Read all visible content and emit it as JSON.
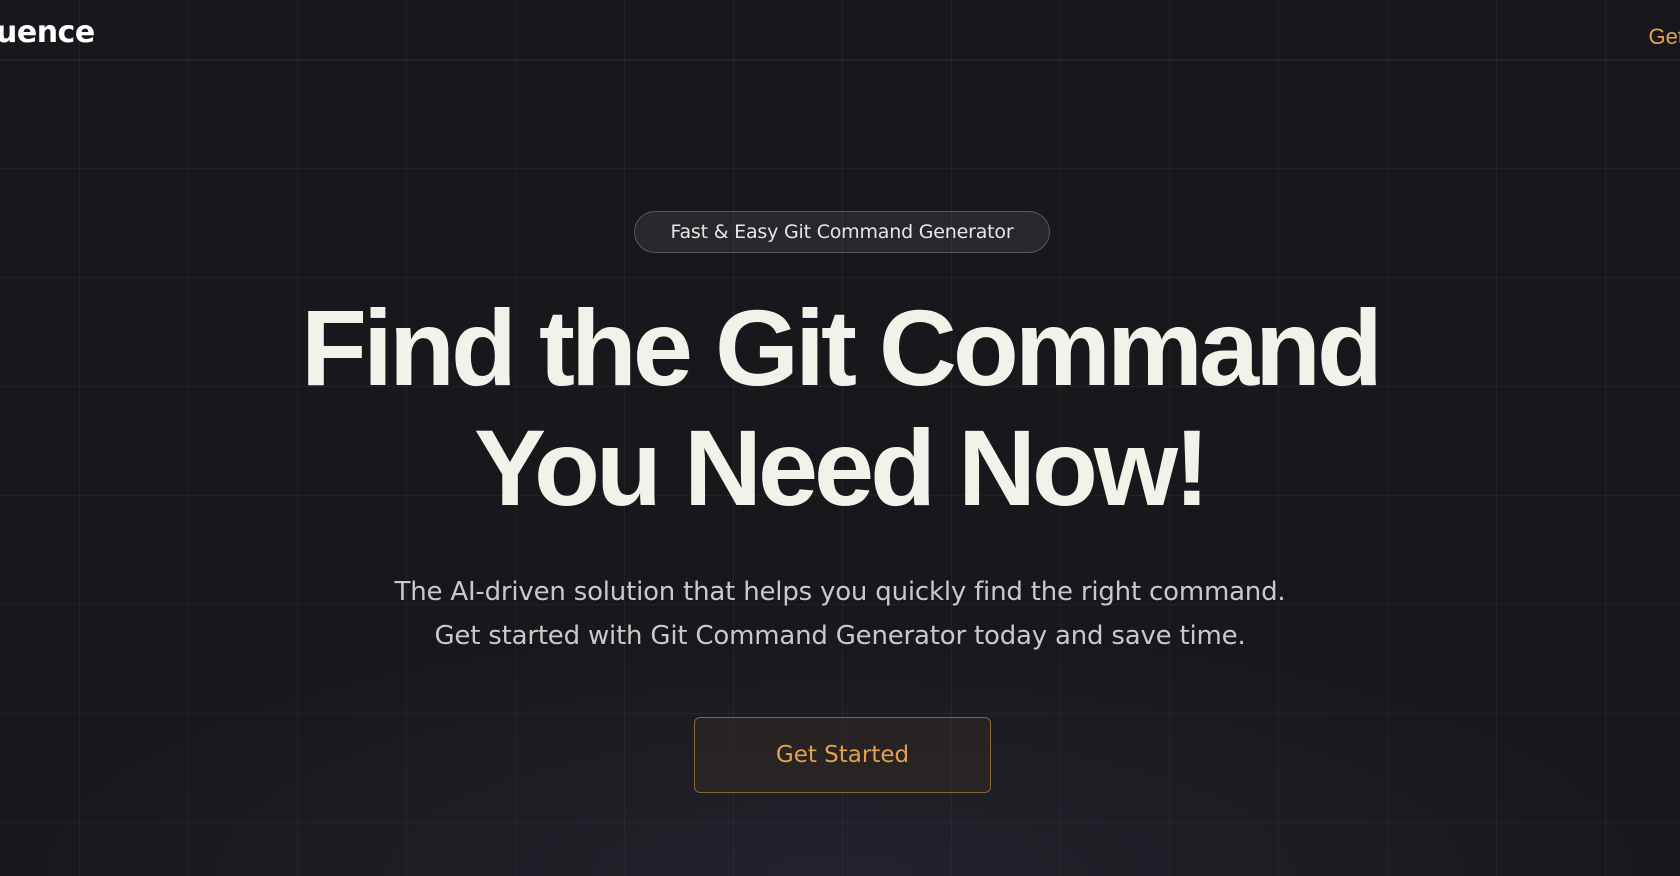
{
  "nav": {
    "logo_text": "uence",
    "cta_label": "Get"
  },
  "hero": {
    "badge_text": "Fast & Easy Git Command Generator",
    "headline_line1": "Find the Git Command",
    "headline_line2": "You Need Now!",
    "subtitle_line1": "The AI-driven solution that helps you quickly find the right command.",
    "subtitle_line2": "Get started with Git Command Generator today and save time.",
    "cta_label": "Get Started"
  },
  "colors": {
    "background": "#18181c",
    "accent": "#e0a24e",
    "headline": "#f2f1ea",
    "text_muted": "#c9c9c9"
  }
}
